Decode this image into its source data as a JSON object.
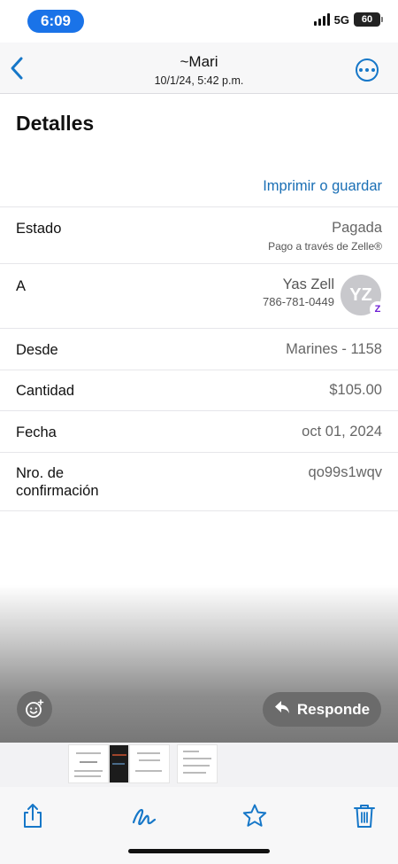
{
  "status_bar": {
    "time": "6:09",
    "network": "5G",
    "battery": "60"
  },
  "header": {
    "title": "~Mari",
    "subtitle": "10/1/24, 5:42 p.m."
  },
  "heading": "Detalles",
  "print_link": "Imprimir o guardar",
  "details": {
    "estado": {
      "label": "Estado",
      "value": "Pagada",
      "sub": "Pago a través de Zelle®"
    },
    "a": {
      "label": "A",
      "name": "Yas Zell",
      "phone": "786-781-0449",
      "avatar_initials": "YZ",
      "badge": "Z"
    },
    "desde": {
      "label": "Desde",
      "value": "Marines - 1158"
    },
    "cantidad": {
      "label": "Cantidad",
      "value": "$105.00"
    },
    "fecha": {
      "label": "Fecha",
      "value": "oct 01, 2024"
    },
    "confirmacion": {
      "label_line1": "Nro. de",
      "label_line2": "confirmación",
      "value": "qo99s1wqv"
    }
  },
  "reply_button": "Responde",
  "colors": {
    "accent": "#1677c8",
    "time_pill": "#1a73e8",
    "zelle_purple": "#6d1ed4"
  },
  "icons": [
    "back-chevron-icon",
    "more-icon",
    "emoji-icon",
    "reply-arrow-icon",
    "share-icon",
    "markup-icon",
    "star-icon",
    "trash-icon"
  ]
}
